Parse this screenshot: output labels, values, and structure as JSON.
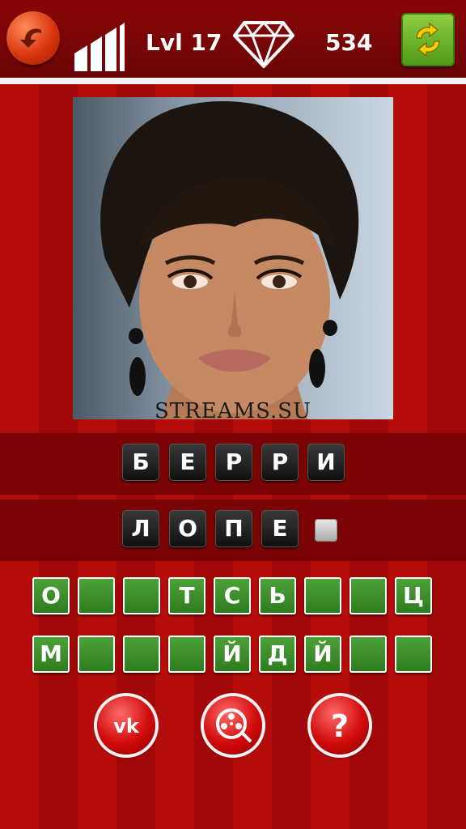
{
  "header": {
    "level": "Lvl 17",
    "coins": "534",
    "icons": [
      "back-arrow-icon",
      "stats-bars-icon",
      "diamond-icon",
      "refresh-icon"
    ]
  },
  "photo": {
    "watermark": "STREAMS.SU"
  },
  "answer": {
    "row1": [
      "Б",
      "Е",
      "Р",
      "Р",
      "И"
    ],
    "row2": [
      "Л",
      "О",
      "П",
      "Е"
    ]
  },
  "letters": {
    "row1": [
      "О",
      "",
      "",
      "Т",
      "С",
      "Ь",
      "",
      "",
      "Ц"
    ],
    "row2": [
      "М",
      "",
      "",
      "",
      "Й",
      "Д",
      "Й",
      "",
      ""
    ]
  },
  "buttons": [
    "vk-icon",
    "film-reel-icon",
    "question-icon"
  ],
  "colors": {
    "background": "#b50c0c",
    "tile_dark": "#1a1a1a",
    "tile_green": "#3c8f2a",
    "accent_orange": "#d9360e"
  }
}
